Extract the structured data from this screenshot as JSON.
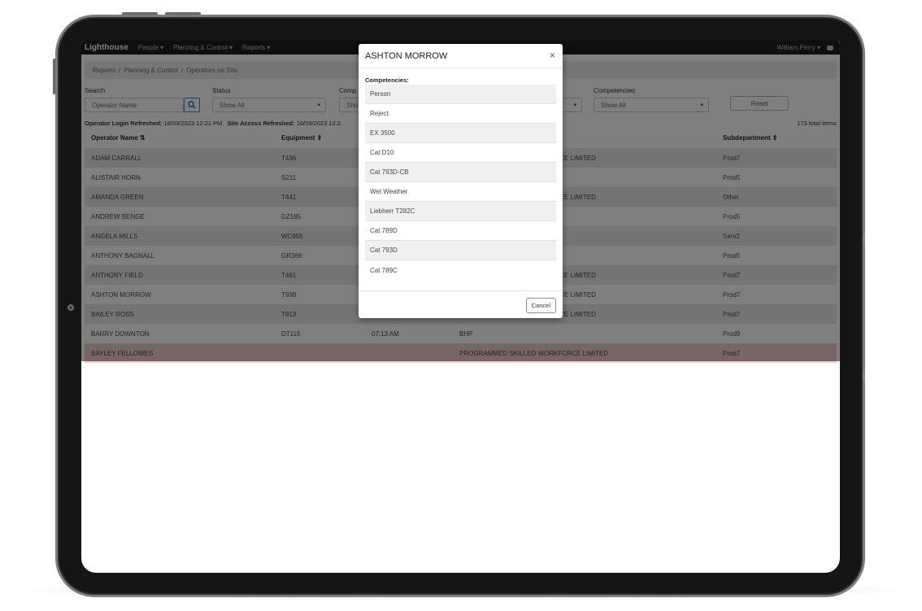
{
  "app": {
    "brand": "Lighthouse",
    "nav": [
      "People",
      "Planning & Control",
      "Reports"
    ],
    "user": "William Perry"
  },
  "breadcrumb": [
    "Reports",
    "/",
    "Planning & Control",
    "/",
    "Operators on Site"
  ],
  "filters": {
    "search_label": "Search",
    "search_placeholder": "Operator Name",
    "status_label": "Status",
    "status_value": "Show All",
    "company_label": "Comp",
    "company_value": "Sho",
    "competencies_label": "Competencies",
    "competencies_value": "Show All",
    "reset_label": "Reset"
  },
  "refresh": {
    "login_label": "Operator Login Refreshed:",
    "login_value": "18/09/2023 12:21 PM",
    "site_label": "Site Access Refreshed:",
    "site_value": "18/09/2023 12:2"
  },
  "total_items": "173 total items",
  "table": {
    "headers": {
      "name": "Operator Name ⇅",
      "equipment": "Equipment ⇕",
      "subdepartment": "Subdepartment ⇕"
    },
    "rows": [
      {
        "name": "ADAM CARRALL",
        "equipment": "T436",
        "time": "",
        "company": "CE LIMITED",
        "sub": "Prod7"
      },
      {
        "name": "ALISTAIR HORN",
        "equipment": "S211",
        "time": "",
        "company": "",
        "sub": "Prod5"
      },
      {
        "name": "AMANDA GREEN",
        "equipment": "T441",
        "time": "",
        "company": "CE LIMITED",
        "sub": "Other"
      },
      {
        "name": "ANDREW BENGE",
        "equipment": "DZ185",
        "time": "",
        "company": "",
        "sub": "Prod5"
      },
      {
        "name": "ANGELA MILLS",
        "equipment": "WC655",
        "time": "",
        "company": "",
        "sub": "Serv2"
      },
      {
        "name": "ANTHONY BAGNALL",
        "equipment": "GR366",
        "time": "",
        "company": "",
        "sub": "Prod5"
      },
      {
        "name": "ANTHONY FIELD",
        "equipment": "T461",
        "time": "",
        "company": "CE LIMITED",
        "sub": "Prod7"
      },
      {
        "name": "ASHTON MORROW",
        "equipment": "T938",
        "time": "",
        "company": "CE LIMITED",
        "sub": "Prod7"
      },
      {
        "name": "BAILEY ROSS",
        "equipment": "T913",
        "time": "",
        "company": "CE LIMITED",
        "sub": "Prod7"
      },
      {
        "name": "BARRY DOWNTON",
        "equipment": "DT115",
        "time": "07:13 AM",
        "company": "BHP",
        "sub": "Prod9"
      },
      {
        "name": "BAYLEY FELLOWES",
        "equipment": "",
        "time": "",
        "company": "PROGRAMMED SKILLED WORKFORCE LIMITED",
        "sub": "Prod7"
      }
    ]
  },
  "modal": {
    "title": "ASHTON MORROW",
    "close": "×",
    "competencies_label": "Competencies:",
    "competencies": [
      "Person",
      "Reject",
      "EX 3500",
      "Cat D10",
      "Cat 793D-CB",
      "Wet Weather",
      "Liebherr T282C",
      "Cat 789D",
      "Cat 793D",
      "Cat 789C"
    ],
    "cancel_label": "Cancel"
  }
}
